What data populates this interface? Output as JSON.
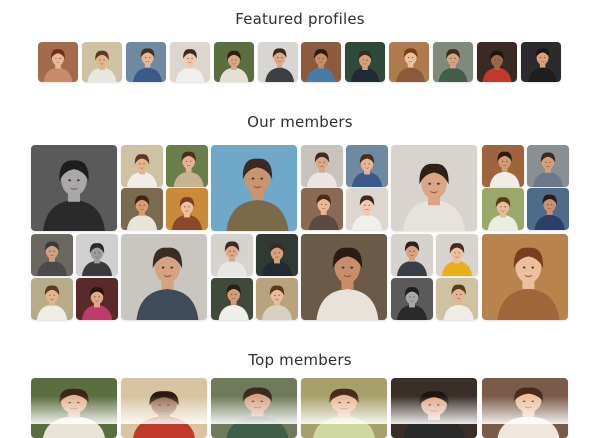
{
  "sections": {
    "featured": {
      "title": "Featured profiles"
    },
    "members": {
      "title": "Our members"
    },
    "top": {
      "title": "Top members"
    }
  },
  "palette": {
    "title_color": "#2f2f2f",
    "photo_backgrounds": [
      "#8a6a55",
      "#d9c4a8",
      "#4f6f8f",
      "#b9a38c",
      "#6b7f55",
      "#c7c2bb",
      "#7a4c36",
      "#3e4b3b",
      "#c9aa86",
      "#5d6770",
      "#9a6b4d",
      "#2d3036"
    ]
  },
  "featured_profiles": [
    {
      "icon": "avatar-woman-redhead",
      "bg": "#a46a4c",
      "hair": "#6b2f1a",
      "skin": "#e9b99a",
      "shirt": "#c98a6a"
    },
    {
      "icon": "avatar-man-outdoors",
      "bg": "#cfc2a3",
      "hair": "#5a3a24",
      "skin": "#e2b58f",
      "shirt": "#e9e6df"
    },
    {
      "icon": "avatar-woman-glasses",
      "bg": "#6f8aa0",
      "hair": "#4a2d1c",
      "skin": "#e5b597",
      "shirt": "#3b5a8a"
    },
    {
      "icon": "avatar-woman-light",
      "bg": "#dcd6cf",
      "hair": "#3a2a22",
      "skin": "#efc8ad",
      "shirt": "#f1efec"
    },
    {
      "icon": "avatar-woman-forest",
      "bg": "#5a6e40",
      "hair": "#2d1f15",
      "skin": "#d9a787",
      "shirt": "#e6e0d4"
    },
    {
      "icon": "avatar-man-studio",
      "bg": "#d8d6d2",
      "hair": "#3b2a20",
      "skin": "#dba88a",
      "shirt": "#3b3f46"
    },
    {
      "icon": "avatar-man-bricks",
      "bg": "#8c5a3c",
      "hair": "#2a1c12",
      "skin": "#c98d6a",
      "shirt": "#4a7aa6"
    },
    {
      "icon": "avatar-man-sunglasses",
      "bg": "#2f4a3a",
      "hair": "#3a2a20",
      "skin": "#d6a07e",
      "shirt": "#1f2a33"
    },
    {
      "icon": "avatar-woman-autumn",
      "bg": "#b07a4c",
      "hair": "#7a3e1c",
      "skin": "#ecbf9f",
      "shirt": "#8a5a3a"
    },
    {
      "icon": "avatar-man-beard",
      "bg": "#7f8a7a",
      "hair": "#3b2c22",
      "skin": "#d5a283",
      "shirt": "#3f5f4a"
    },
    {
      "icon": "avatar-woman-night",
      "bg": "#3a2a22",
      "hair": "#1f1510",
      "skin": "#9a6a4c",
      "shirt": "#c0392b"
    },
    {
      "icon": "avatar-woman-dark",
      "bg": "#2b2b2b",
      "hair": "#1a1412",
      "skin": "#d9a07e",
      "shirt": "#1e1e1e"
    }
  ],
  "member_photos": [
    {
      "icon": "avatar-man-bw-portrait",
      "bg": "#5a5a5a",
      "hair": "#1e1e1e",
      "skin": "#a8a8a8",
      "shirt": "#2a2a2a"
    },
    {
      "icon": "avatar-man-outdoors",
      "bg": "#cfc2a3",
      "hair": "#5a3a24",
      "skin": "#e2b58f",
      "shirt": "#f0ede6"
    },
    {
      "icon": "avatar-woman-forest",
      "bg": "#6a7e4c",
      "hair": "#4a2c1a",
      "skin": "#e4b292",
      "shirt": "#c9b38f"
    },
    {
      "icon": "avatar-woman-sunglasses",
      "bg": "#7a6a50",
      "hair": "#3a2616",
      "skin": "#d99b74",
      "shirt": "#e9e4d8"
    },
    {
      "icon": "avatar-woman-autumn",
      "bg": "#c98a3a",
      "hair": "#7a3e1c",
      "skin": "#ecbf9f",
      "shirt": "#8a4a2a"
    },
    {
      "icon": "avatar-man-beach",
      "bg": "#6fa8c8",
      "hair": "#3a2a20",
      "skin": "#c9956f",
      "shirt": "#7a6a4a"
    },
    {
      "icon": "avatar-man-studio",
      "bg": "#c8c4bd",
      "hair": "#3b2a20",
      "skin": "#dba88a",
      "shirt": "#e9e6e2"
    },
    {
      "icon": "avatar-woman-glasses",
      "bg": "#6f8aa0",
      "hair": "#4a2d1c",
      "skin": "#e5b597",
      "shirt": "#3b5a8a"
    },
    {
      "icon": "avatar-woman-smiling",
      "bg": "#8a6a55",
      "hair": "#4a2a1a",
      "skin": "#e8b896",
      "shirt": "#5a4a40"
    },
    {
      "icon": "avatar-woman-light",
      "bg": "#dcd6cf",
      "hair": "#3a2a22",
      "skin": "#efc8ad",
      "shirt": "#f1efec"
    },
    {
      "icon": "avatar-man-studio-2",
      "bg": "#d8d4cd",
      "hair": "#2e2018",
      "skin": "#d9a686",
      "shirt": "#e6e2dc"
    },
    {
      "icon": "avatar-man-bricks",
      "bg": "#a0643c",
      "hair": "#2a1c12",
      "skin": "#d29a76",
      "shirt": "#f0ede8"
    },
    {
      "icon": "avatar-man-campus",
      "bg": "#8a8f94",
      "hair": "#3a2a20",
      "skin": "#d4a07c",
      "shirt": "#6a7a8a"
    },
    {
      "icon": "avatar-woman-garden",
      "bg": "#9aa86a",
      "hair": "#5a3a1c",
      "skin": "#e6bc9a",
      "shirt": "#e7efe2"
    },
    {
      "icon": "avatar-man-blue",
      "bg": "#4e6b8a",
      "hair": "#2a1c14",
      "skin": "#c9926e",
      "shirt": "#2b3f6a"
    },
    {
      "icon": "avatar-man-glasses-hat",
      "bg": "#6a6660",
      "hair": "#3a3a3a",
      "skin": "#cfa080",
      "shirt": "#4a4a4a"
    },
    {
      "icon": "avatar-man-bw-closeup",
      "bg": "#d0d0d0",
      "hair": "#2a2a2a",
      "skin": "#9c9c9c",
      "shirt": "#3a3a3a"
    },
    {
      "icon": "avatar-man-beard",
      "bg": "#c9c5bf",
      "hair": "#3b2c22",
      "skin": "#d5a283",
      "shirt": "#3f4a5a"
    },
    {
      "icon": "avatar-man-glasses",
      "bg": "#d6d2cc",
      "hair": "#3a2a22",
      "skin": "#dca88a",
      "shirt": "#e8e6e2"
    },
    {
      "icon": "avatar-man-sunglasses-car",
      "bg": "#2f3a34",
      "hair": "#3a2a20",
      "skin": "#d6a07e",
      "shirt": "#1f2a33"
    },
    {
      "icon": "avatar-man-park",
      "bg": "#6b5a48",
      "hair": "#2a1c12",
      "skin": "#c98d6a",
      "shirt": "#e8e2da"
    },
    {
      "icon": "avatar-man-studio-3",
      "bg": "#d6d3ce",
      "hair": "#2d2118",
      "skin": "#d7a382",
      "shirt": "#3a3f47"
    },
    {
      "icon": "avatar-woman-yellow",
      "bg": "#d8d3cc",
      "hair": "#4a2a1a",
      "skin": "#eebf9c",
      "shirt": "#e8b11c"
    },
    {
      "icon": "avatar-woman-autumn-2",
      "bg": "#b8834c",
      "hair": "#7a3e1c",
      "skin": "#ecbf9f",
      "shirt": "#a0663a"
    },
    {
      "icon": "avatar-man-outdoors-2",
      "bg": "#b7ac8a",
      "hair": "#5a3a24",
      "skin": "#e2b58f",
      "shirt": "#f0ede6"
    },
    {
      "icon": "avatar-woman-pink",
      "bg": "#5a2a2a",
      "hair": "#2a1410",
      "skin": "#e0a88a",
      "shirt": "#c0396b"
    },
    {
      "icon": "avatar-man-white-shirt",
      "bg": "#3f4a3a",
      "hair": "#2a1c12",
      "skin": "#d19c78",
      "shirt": "#eeeeea"
    },
    {
      "icon": "avatar-woman-garden-2",
      "bg": "#b9a37c",
      "hair": "#5a3a1c",
      "skin": "#e6bc9a",
      "shirt": "#d8d0c0"
    }
  ],
  "top_members": [
    {
      "icon": "avatar-woman-park",
      "bg": "#5a6e40",
      "hair": "#3a2616",
      "skin": "#e4b292",
      "shirt": "#e9e4d8"
    },
    {
      "icon": "avatar-woman-red-scarf",
      "bg": "#d8c4a0",
      "hair": "#2a1a12",
      "skin": "#9a6a4c",
      "shirt": "#c0392b"
    },
    {
      "icon": "avatar-man-forest",
      "bg": "#6f7a5a",
      "hair": "#3a2a20",
      "skin": "#d5a283",
      "shirt": "#3f5f4a"
    },
    {
      "icon": "avatar-woman-meadow",
      "bg": "#a8a06a",
      "hair": "#4a2a1a",
      "skin": "#e8b896",
      "shirt": "#cfd8a0"
    },
    {
      "icon": "avatar-woman-dark-room",
      "bg": "#3a2e28",
      "hair": "#1f1510",
      "skin": "#e0a88a",
      "shirt": "#2a2a2a"
    },
    {
      "icon": "avatar-woman-smiling-2",
      "bg": "#7a5a48",
      "hair": "#4a2a1a",
      "skin": "#ecbf9f",
      "shirt": "#f0e6dc"
    }
  ]
}
